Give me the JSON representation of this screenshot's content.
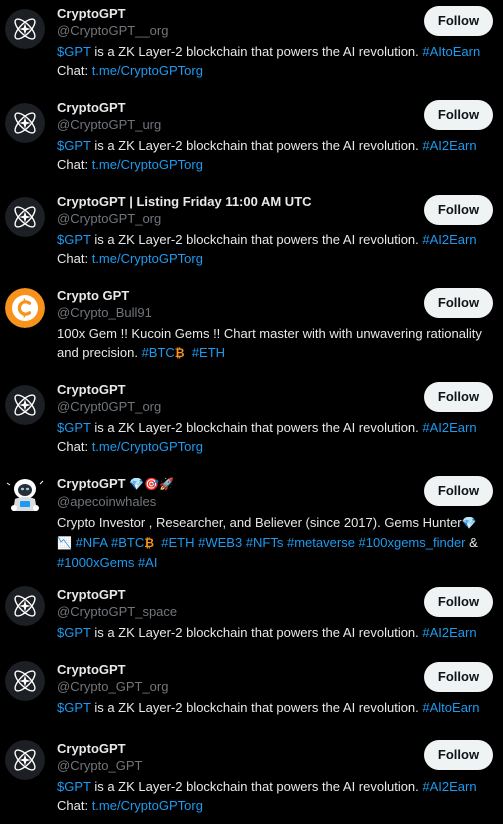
{
  "colors": {
    "background": "#000000",
    "text_primary": "#e7e9ea",
    "text_secondary": "#71767b",
    "link": "#1d9bf0",
    "follow_button_bg": "#eff3f4",
    "follow_button_text": "#0f1419"
  },
  "accounts": [
    {
      "avatar": "atom-logo-icon",
      "name": "CryptoGPT",
      "handle": "@CryptoGPT__org",
      "bio": {
        "ticker": "$GPT",
        "text": " is a ZK Layer-2 blockchain that powers the AI revolution. ",
        "hashtag": "#AItoEarn",
        "chat_label": "Chat: ",
        "chat_link": "t.me/CryptoGPTorg"
      },
      "follow_label": "Follow"
    },
    {
      "avatar": "atom-logo-icon",
      "name": "CryptoGPT",
      "handle": "@CryptoGPT_urg",
      "bio": {
        "ticker": "$GPT",
        "text": " is a ZK Layer-2 blockchain that powers the AI revolution. ",
        "hashtag": "#AI2Earn",
        "chat_label": "Chat: ",
        "chat_link": "t.me/CryptoGPTorg"
      },
      "follow_label": "Follow"
    },
    {
      "avatar": "atom-logo-icon",
      "name": "CryptoGPT | Listing Friday 11:00 AM UTC",
      "handle": "@CryptoGPT_org",
      "bio": {
        "ticker": "$GPT",
        "text": " is a ZK Layer-2 blockchain that powers the AI revolution. ",
        "hashtag": "#AI2Earn",
        "chat_label": "Chat: ",
        "chat_link": "t.me/CryptoGPTorg"
      },
      "follow_label": "Follow"
    },
    {
      "avatar": "bitcoin-logo-icon",
      "name": "Crypto GPT",
      "handle": "@Crypto_Bull91",
      "bio": {
        "line1": "100x Gem !! Kucoin Gems !! Chart master with with unwavering rationality and precision. ",
        "tag1": "#BTC",
        "emoji1": "₿",
        "tag2": "#ETH"
      },
      "follow_label": "Follow"
    },
    {
      "avatar": "atom-logo-icon",
      "name": "CryptoGPT",
      "handle": "@Crypt0GPT_org",
      "bio": {
        "ticker": "$GPT",
        "text": " is a ZK Layer-2 blockchain that powers the AI revolution. ",
        "hashtag": "#AI2Earn",
        "chat_label": "Chat: ",
        "chat_link": "t.me/CryptoGPTorg"
      },
      "follow_label": "Follow"
    },
    {
      "avatar": "astronaut-ape-icon",
      "name": "CryptoGPT",
      "name_emoji": "💎🎯🚀",
      "handle": "@apecoinwhales",
      "bio": {
        "intro": "Crypto Investor , Researcher, and Believer (since 2017). Gems Hunter",
        "emoji_gem": "💎",
        "emoji_chart": "📉",
        "tag_nfa": "#NFA",
        "tag_btc": "#BTC",
        "emoji_btc": "₿",
        "tag_eth": "#ETH",
        "tag_web3": "#WEB3",
        "tag_nfts": "#NFTs",
        "tag_metaverse": "#metaverse",
        "tag_100x": "#100xgems_finder",
        "amp": " & ",
        "tag_1000x": "#1000xGems",
        "tag_ai": "#AI"
      },
      "follow_label": "Follow"
    },
    {
      "avatar": "atom-logo-icon",
      "name": "CryptoGPT",
      "handle": "@CryptoGPT_space",
      "bio": {
        "ticker": "$GPT",
        "text": " is a ZK Layer-2 blockchain that powers the AI revolution. ",
        "hashtag": "#AI2Earn"
      },
      "follow_label": "Follow"
    },
    {
      "avatar": "atom-logo-icon",
      "name": "CryptoGPT",
      "handle": "@Crypto_GPT_org",
      "bio": {
        "ticker": "$GPT",
        "text": " is a ZK Layer-2 blockchain that powers the AI revolution. ",
        "hashtag": "#AltoEarn"
      },
      "follow_label": "Follow"
    },
    {
      "avatar": "atom-logo-icon",
      "name": "CryptoGPT",
      "handle": "@Crypto_GPT",
      "bio": {
        "ticker": "$GPT",
        "text": " is a ZK Layer-2 blockchain that powers the AI revolution. ",
        "hashtag": "#AI2Earn",
        "chat_label": "Chat: ",
        "chat_link": "t.me/CryptoGPTorg"
      },
      "follow_label": "Follow"
    }
  ]
}
